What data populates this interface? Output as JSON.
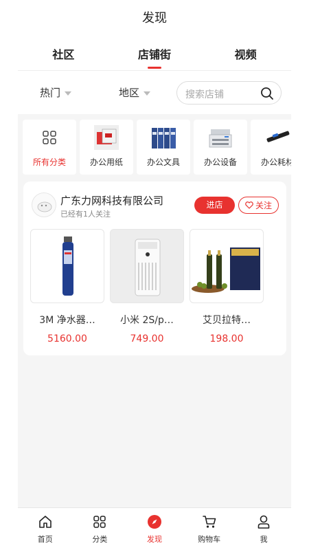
{
  "header": {
    "title": "发现",
    "tabs": [
      {
        "label": "社区"
      },
      {
        "label": "店铺街"
      },
      {
        "label": "视频"
      }
    ],
    "active_tab": "店铺街"
  },
  "filters": {
    "hot": "热门",
    "region": "地区",
    "search_placeholder": "搜索店铺"
  },
  "categories": [
    {
      "label": "所有分类",
      "icon": "grid-icon",
      "active": true
    },
    {
      "label": "办公用纸",
      "icon": "paper-product-image"
    },
    {
      "label": "办公文具",
      "icon": "binders-image"
    },
    {
      "label": "办公设备",
      "icon": "printer-image"
    },
    {
      "label": "办公耗材",
      "icon": "toner-image"
    }
  ],
  "store": {
    "name": "广东力网科技有限公司",
    "followers": "已经有1人关注",
    "enter_label": "进店",
    "follow_label": "关注",
    "products": [
      {
        "name": "3M 净水器…",
        "price": "5160.00",
        "image": "water-filter-image"
      },
      {
        "name": "小米 2S/p…",
        "price": "749.00",
        "image": "air-purifier-image"
      },
      {
        "name": "艾贝拉特…",
        "price": "198.00",
        "image": "olive-oil-image"
      }
    ]
  },
  "tabbar": [
    {
      "label": "首页",
      "icon": "home-icon"
    },
    {
      "label": "分类",
      "icon": "category-icon"
    },
    {
      "label": "发现",
      "icon": "discover-icon",
      "active": true
    },
    {
      "label": "购物车",
      "icon": "cart-icon"
    },
    {
      "label": "我",
      "icon": "user-icon"
    }
  ],
  "colors": {
    "accent": "#e8322f",
    "background": "#f5f5f5",
    "text": "#222222"
  }
}
